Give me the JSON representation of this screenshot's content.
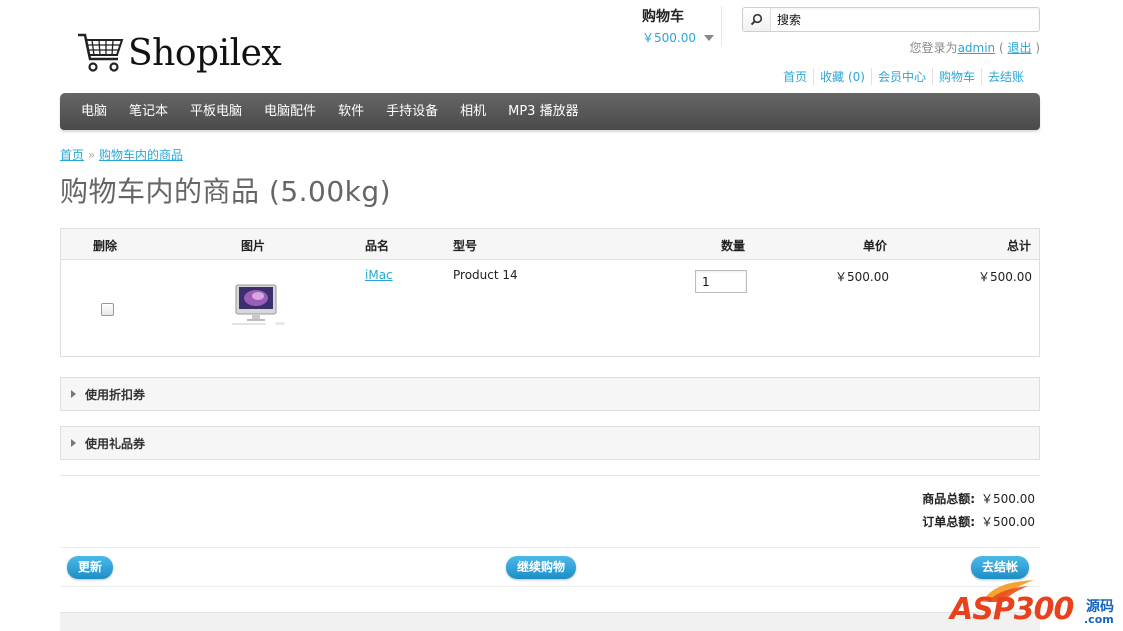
{
  "header": {
    "logo_text": "Shopilex",
    "cart_title": "购物车",
    "cart_total": "￥500.00",
    "search_value": "搜索",
    "welcome_prefix": "您登录为",
    "welcome_user": "admin",
    "welcome_paren_open": " ( ",
    "welcome_logout": "退出",
    "welcome_paren_close": " )",
    "top_links": [
      "首页",
      "收藏 (0)",
      "会员中心",
      "购物车",
      "去结账"
    ]
  },
  "menu": [
    "电脑",
    "笔记本",
    "平板电脑",
    "电脑配件",
    "软件",
    "手持设备",
    "相机",
    "MP3 播放器"
  ],
  "breadcrumb": {
    "home": "首页",
    "separator": " » ",
    "current": "购物车内的商品"
  },
  "page_title": "购物车内的商品  (5.00kg)",
  "table": {
    "headers": {
      "remove": "删除",
      "image": "图片",
      "name": "品名",
      "model": "型号",
      "quantity": "数量",
      "unit_price": "单价",
      "total": "总计"
    },
    "rows": [
      {
        "name": "iMac",
        "model": "Product 14",
        "quantity": "1",
        "unit_price": "￥500.00",
        "total": "￥500.00"
      }
    ]
  },
  "sections": {
    "coupon": "使用折扣券",
    "voucher": "使用礼品券"
  },
  "totals": {
    "subtotal_label": "商品总额:",
    "subtotal_value": "￥500.00",
    "order_label": "订单总额:",
    "order_value": "￥500.00"
  },
  "buttons": {
    "update": "更新",
    "continue": "继续购物",
    "checkout": "去结帐"
  },
  "watermark": {
    "text": "ASP300",
    "sub": "源码",
    "domain": ".com"
  },
  "colors": {
    "link": "#2aa6d6",
    "menu_bg": "#555555",
    "button": "#1d8dc6"
  }
}
